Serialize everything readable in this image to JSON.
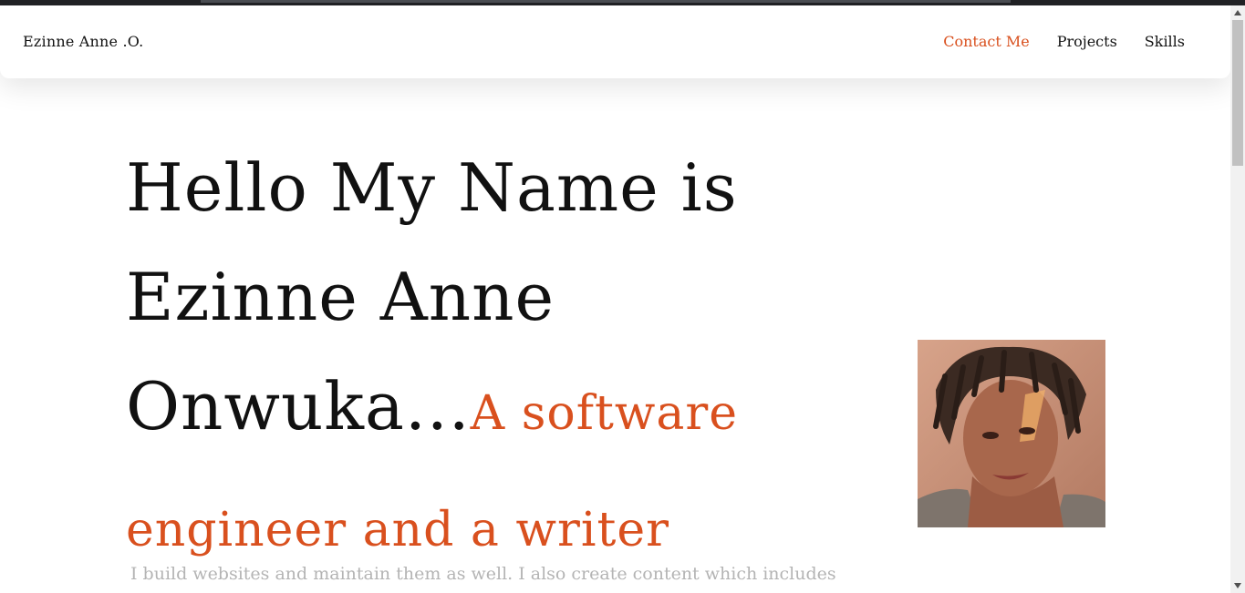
{
  "navbar": {
    "brand": "Ezinne Anne .O.",
    "links": [
      {
        "label": "Contact Me"
      },
      {
        "label": "Projects"
      },
      {
        "label": "Skills"
      }
    ],
    "active_color": "#d9501e"
  },
  "hero": {
    "title": "Hello My Name is Ezinne Anne Onwuka...",
    "tagline": "A software engineer and a writer",
    "paragraph": "I build websites and maintain them as well. I also create content which includes"
  },
  "colors": {
    "accent": "#d9501e",
    "text": "#111111",
    "muted": "#b4b4b4"
  }
}
